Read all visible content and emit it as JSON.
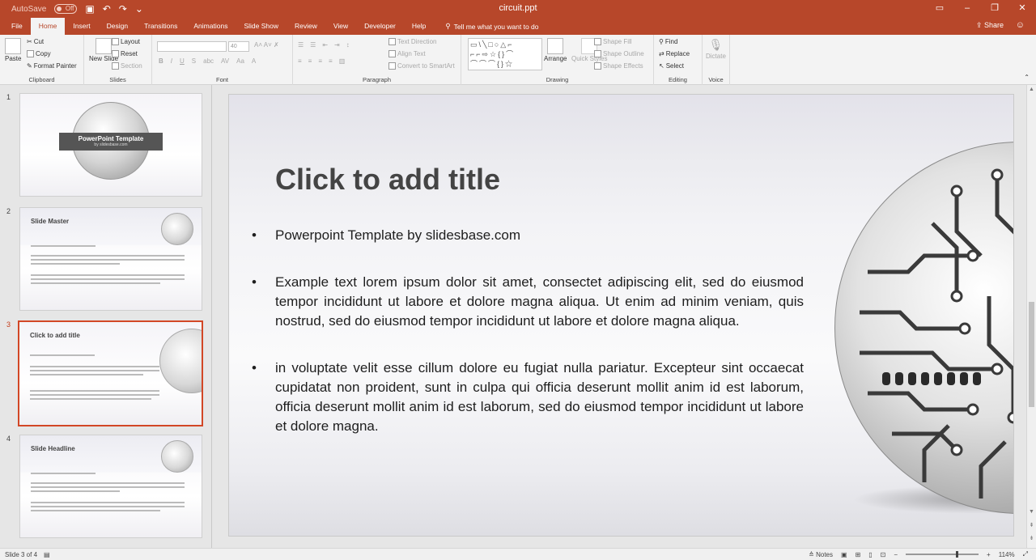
{
  "window": {
    "autosave_label": "AutoSave",
    "autosave_state": "Off",
    "title": "circuit.ppt"
  },
  "tabs": [
    "File",
    "Home",
    "Insert",
    "Design",
    "Transitions",
    "Animations",
    "Slide Show",
    "Review",
    "View",
    "Developer",
    "Help"
  ],
  "active_tab": "Home",
  "tell_me": "Tell me what you want to do",
  "share_label": "Share",
  "ribbon": {
    "clipboard": {
      "label": "Clipboard",
      "paste": "Paste",
      "cut": "Cut",
      "copy": "Copy",
      "format_painter": "Format Painter"
    },
    "slides": {
      "label": "Slides",
      "new_slide": "New Slide",
      "layout": "Layout",
      "reset": "Reset",
      "section": "Section"
    },
    "font": {
      "label": "Font",
      "size": "40"
    },
    "paragraph": {
      "label": "Paragraph",
      "text_direction": "Text Direction",
      "align_text": "Align Text",
      "convert_smartart": "Convert to SmartArt"
    },
    "drawing": {
      "label": "Drawing",
      "arrange": "Arrange",
      "quick_styles": "Quick Styles",
      "shape_fill": "Shape Fill",
      "shape_outline": "Shape Outline",
      "shape_effects": "Shape Effects"
    },
    "editing": {
      "label": "Editing",
      "find": "Find",
      "replace": "Replace",
      "select": "Select"
    },
    "voice": {
      "label": "Voice",
      "dictate": "Dictate"
    }
  },
  "thumbnails": [
    {
      "num": "1",
      "title": "PowerPoint Template",
      "subtitle": "by slidesbase.com"
    },
    {
      "num": "2",
      "title": "Slide Master"
    },
    {
      "num": "3",
      "title": "Click to add title"
    },
    {
      "num": "4",
      "title": "Slide Headline"
    }
  ],
  "slide": {
    "title": "Click to add title",
    "bullets": [
      "Powerpoint Template by slidesbase.com",
      "Example text lorem ipsum dolor sit amet, consectet adipiscing elit, sed do eiusmod tempor incididunt ut labore et dolore magna aliqua. Ut enim ad minim veniam, quis nostrud, sed do eiusmod tempor incididunt ut labore et dolore magna aliqua.",
      "in voluptate velit esse cillum dolore eu fugiat nulla pariatur. Excepteur sint occaecat cupidatat non proident, sunt in culpa qui officia deserunt mollit anim id est laborum, officia deserunt mollit anim id est laborum, sed do eiusmod tempor incididunt ut labore et dolore magna."
    ]
  },
  "status": {
    "slide_info": "Slide 3 of 4",
    "notes": "Notes",
    "zoom": "114%"
  },
  "colors": {
    "accent": "#b7472a",
    "selected_border": "#d24726"
  }
}
